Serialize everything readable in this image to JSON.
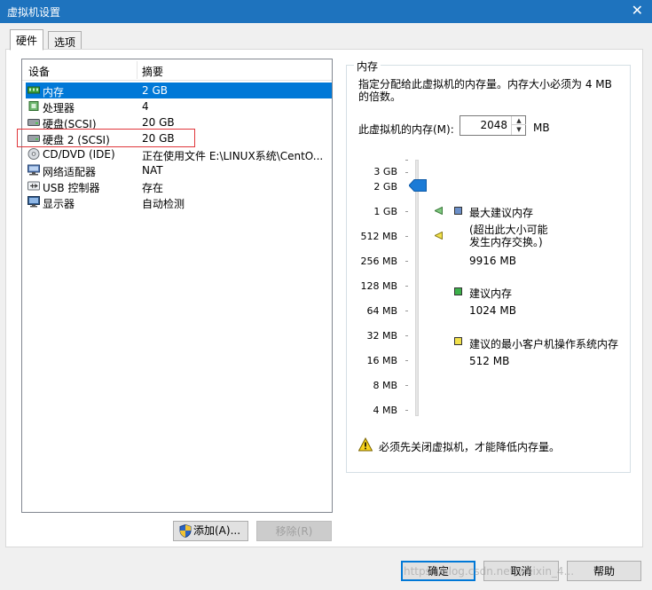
{
  "window": {
    "title": "虚拟机设置",
    "close_glyph": "✕"
  },
  "tabs": [
    {
      "label": "硬件"
    },
    {
      "label": "选项"
    }
  ],
  "device_list": {
    "headers": {
      "device": "设备",
      "summary": "摘要"
    },
    "rows": [
      {
        "name": "内存",
        "summary": "2 GB"
      },
      {
        "name": "处理器",
        "summary": "4"
      },
      {
        "name": "硬盘(SCSI)",
        "summary": "20 GB"
      },
      {
        "name": "硬盘 2 (SCSI)",
        "summary": "20 GB"
      },
      {
        "name": "CD/DVD (IDE)",
        "summary": "正在使用文件 E:\\LINUX系统\\CentO..."
      },
      {
        "name": "网络适配器",
        "summary": "NAT"
      },
      {
        "name": "USB 控制器",
        "summary": "存在"
      },
      {
        "name": "显示器",
        "summary": "自动检测"
      }
    ],
    "selected_index": 0
  },
  "buttons": {
    "add": "添加(A)...",
    "remove": "移除(R)",
    "ok": "确定",
    "cancel": "取消",
    "help": "帮助"
  },
  "memory": {
    "group_title": "内存",
    "description": "指定分配给此虚拟机的内存量。内存大小必须为 4 MB 的倍数。",
    "label": "此虚拟机的内存(M):",
    "value": "2048",
    "unit": "MB",
    "scale": [
      "3 GB",
      "2 GB",
      "1 GB",
      "512 MB",
      "256 MB",
      "128 MB",
      "64 MB",
      "32 MB",
      "16 MB",
      "8 MB",
      "4 MB"
    ],
    "max_recommended": {
      "label": "最大建议内存",
      "note": "(超出此大小可能\n发生内存交换。)",
      "value": "9916 MB",
      "color": "#6b8fc8"
    },
    "recommended": {
      "label": "建议内存",
      "value": "1024 MB",
      "color": "#3cb04a"
    },
    "min_recommended": {
      "label": "建议的最小客户机操作系统内存",
      "value": "512 MB",
      "color": "#f2e14b"
    },
    "warning": "必须先关闭虚拟机，才能降低内存量。"
  },
  "watermark": "https://blog.csdn.net/weixin_4..."
}
